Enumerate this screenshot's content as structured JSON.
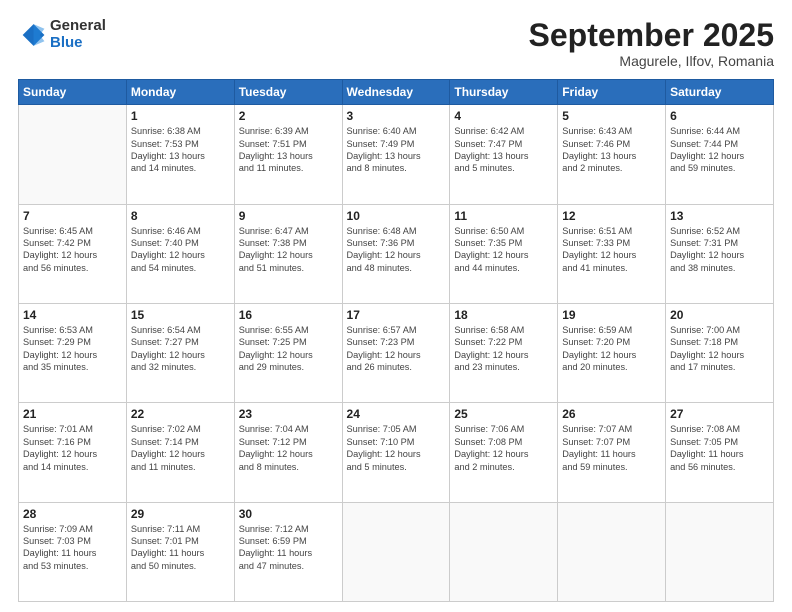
{
  "header": {
    "logo_general": "General",
    "logo_blue": "Blue",
    "month": "September 2025",
    "location": "Magurele, Ilfov, Romania"
  },
  "weekdays": [
    "Sunday",
    "Monday",
    "Tuesday",
    "Wednesday",
    "Thursday",
    "Friday",
    "Saturday"
  ],
  "weeks": [
    [
      {
        "day": "",
        "sunrise": "",
        "sunset": "",
        "daylight": ""
      },
      {
        "day": "1",
        "sunrise": "Sunrise: 6:38 AM",
        "sunset": "Sunset: 7:53 PM",
        "daylight": "Daylight: 13 hours and 14 minutes."
      },
      {
        "day": "2",
        "sunrise": "Sunrise: 6:39 AM",
        "sunset": "Sunset: 7:51 PM",
        "daylight": "Daylight: 13 hours and 11 minutes."
      },
      {
        "day": "3",
        "sunrise": "Sunrise: 6:40 AM",
        "sunset": "Sunset: 7:49 PM",
        "daylight": "Daylight: 13 hours and 8 minutes."
      },
      {
        "day": "4",
        "sunrise": "Sunrise: 6:42 AM",
        "sunset": "Sunset: 7:47 PM",
        "daylight": "Daylight: 13 hours and 5 minutes."
      },
      {
        "day": "5",
        "sunrise": "Sunrise: 6:43 AM",
        "sunset": "Sunset: 7:46 PM",
        "daylight": "Daylight: 13 hours and 2 minutes."
      },
      {
        "day": "6",
        "sunrise": "Sunrise: 6:44 AM",
        "sunset": "Sunset: 7:44 PM",
        "daylight": "Daylight: 12 hours and 59 minutes."
      }
    ],
    [
      {
        "day": "7",
        "sunrise": "Sunrise: 6:45 AM",
        "sunset": "Sunset: 7:42 PM",
        "daylight": "Daylight: 12 hours and 56 minutes."
      },
      {
        "day": "8",
        "sunrise": "Sunrise: 6:46 AM",
        "sunset": "Sunset: 7:40 PM",
        "daylight": "Daylight: 12 hours and 54 minutes."
      },
      {
        "day": "9",
        "sunrise": "Sunrise: 6:47 AM",
        "sunset": "Sunset: 7:38 PM",
        "daylight": "Daylight: 12 hours and 51 minutes."
      },
      {
        "day": "10",
        "sunrise": "Sunrise: 6:48 AM",
        "sunset": "Sunset: 7:36 PM",
        "daylight": "Daylight: 12 hours and 48 minutes."
      },
      {
        "day": "11",
        "sunrise": "Sunrise: 6:50 AM",
        "sunset": "Sunset: 7:35 PM",
        "daylight": "Daylight: 12 hours and 44 minutes."
      },
      {
        "day": "12",
        "sunrise": "Sunrise: 6:51 AM",
        "sunset": "Sunset: 7:33 PM",
        "daylight": "Daylight: 12 hours and 41 minutes."
      },
      {
        "day": "13",
        "sunrise": "Sunrise: 6:52 AM",
        "sunset": "Sunset: 7:31 PM",
        "daylight": "Daylight: 12 hours and 38 minutes."
      }
    ],
    [
      {
        "day": "14",
        "sunrise": "Sunrise: 6:53 AM",
        "sunset": "Sunset: 7:29 PM",
        "daylight": "Daylight: 12 hours and 35 minutes."
      },
      {
        "day": "15",
        "sunrise": "Sunrise: 6:54 AM",
        "sunset": "Sunset: 7:27 PM",
        "daylight": "Daylight: 12 hours and 32 minutes."
      },
      {
        "day": "16",
        "sunrise": "Sunrise: 6:55 AM",
        "sunset": "Sunset: 7:25 PM",
        "daylight": "Daylight: 12 hours and 29 minutes."
      },
      {
        "day": "17",
        "sunrise": "Sunrise: 6:57 AM",
        "sunset": "Sunset: 7:23 PM",
        "daylight": "Daylight: 12 hours and 26 minutes."
      },
      {
        "day": "18",
        "sunrise": "Sunrise: 6:58 AM",
        "sunset": "Sunset: 7:22 PM",
        "daylight": "Daylight: 12 hours and 23 minutes."
      },
      {
        "day": "19",
        "sunrise": "Sunrise: 6:59 AM",
        "sunset": "Sunset: 7:20 PM",
        "daylight": "Daylight: 12 hours and 20 minutes."
      },
      {
        "day": "20",
        "sunrise": "Sunrise: 7:00 AM",
        "sunset": "Sunset: 7:18 PM",
        "daylight": "Daylight: 12 hours and 17 minutes."
      }
    ],
    [
      {
        "day": "21",
        "sunrise": "Sunrise: 7:01 AM",
        "sunset": "Sunset: 7:16 PM",
        "daylight": "Daylight: 12 hours and 14 minutes."
      },
      {
        "day": "22",
        "sunrise": "Sunrise: 7:02 AM",
        "sunset": "Sunset: 7:14 PM",
        "daylight": "Daylight: 12 hours and 11 minutes."
      },
      {
        "day": "23",
        "sunrise": "Sunrise: 7:04 AM",
        "sunset": "Sunset: 7:12 PM",
        "daylight": "Daylight: 12 hours and 8 minutes."
      },
      {
        "day": "24",
        "sunrise": "Sunrise: 7:05 AM",
        "sunset": "Sunset: 7:10 PM",
        "daylight": "Daylight: 12 hours and 5 minutes."
      },
      {
        "day": "25",
        "sunrise": "Sunrise: 7:06 AM",
        "sunset": "Sunset: 7:08 PM",
        "daylight": "Daylight: 12 hours and 2 minutes."
      },
      {
        "day": "26",
        "sunrise": "Sunrise: 7:07 AM",
        "sunset": "Sunset: 7:07 PM",
        "daylight": "Daylight: 11 hours and 59 minutes."
      },
      {
        "day": "27",
        "sunrise": "Sunrise: 7:08 AM",
        "sunset": "Sunset: 7:05 PM",
        "daylight": "Daylight: 11 hours and 56 minutes."
      }
    ],
    [
      {
        "day": "28",
        "sunrise": "Sunrise: 7:09 AM",
        "sunset": "Sunset: 7:03 PM",
        "daylight": "Daylight: 11 hours and 53 minutes."
      },
      {
        "day": "29",
        "sunrise": "Sunrise: 7:11 AM",
        "sunset": "Sunset: 7:01 PM",
        "daylight": "Daylight: 11 hours and 50 minutes."
      },
      {
        "day": "30",
        "sunrise": "Sunrise: 7:12 AM",
        "sunset": "Sunset: 6:59 PM",
        "daylight": "Daylight: 11 hours and 47 minutes."
      },
      {
        "day": "",
        "sunrise": "",
        "sunset": "",
        "daylight": ""
      },
      {
        "day": "",
        "sunrise": "",
        "sunset": "",
        "daylight": ""
      },
      {
        "day": "",
        "sunrise": "",
        "sunset": "",
        "daylight": ""
      },
      {
        "day": "",
        "sunrise": "",
        "sunset": "",
        "daylight": ""
      }
    ]
  ]
}
